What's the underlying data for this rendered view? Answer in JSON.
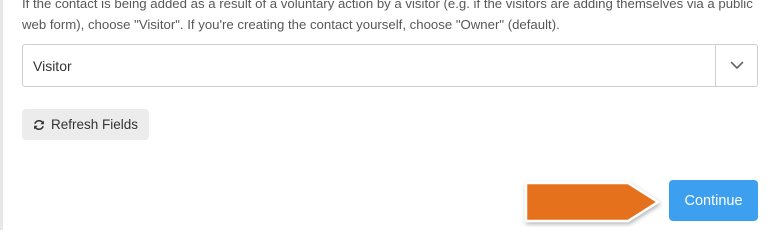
{
  "form": {
    "help_text": "If the contact is being added as a result of a voluntary action by a visitor (e.g. if the visitors are adding themselves via a public web form), choose \"Visitor\". If you're creating the contact yourself, choose \"Owner\" (default).",
    "contact_source_select": {
      "selected": "Visitor",
      "toggle_icon": "chevron-down-icon"
    },
    "refresh_button": {
      "label": "Refresh Fields",
      "icon": "refresh-icon"
    },
    "continue_button": {
      "label": "Continue"
    }
  },
  "annotation": {
    "arrow_color": "#e5711a",
    "arrow_points_to": "continue-button"
  },
  "colors": {
    "primary_button": "#3d9ff0",
    "secondary_button": "#ececec"
  }
}
